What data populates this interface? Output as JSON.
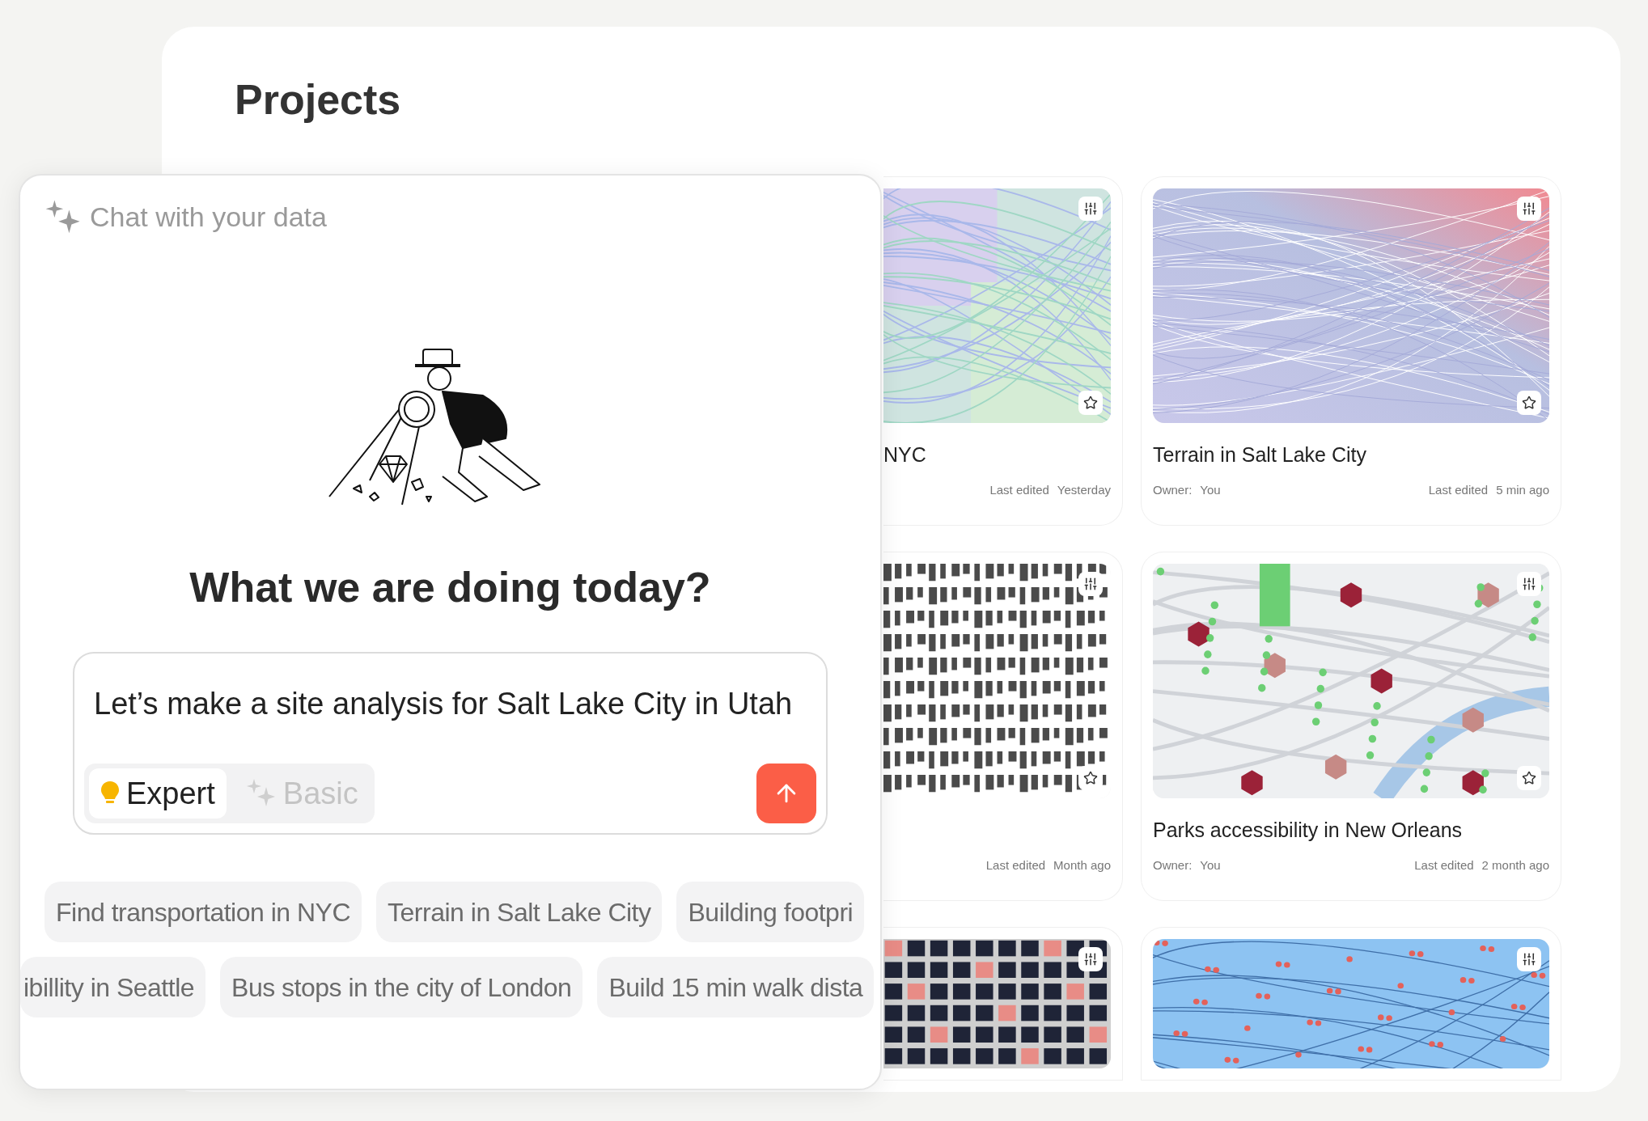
{
  "page": {
    "title": "Projects"
  },
  "projects": [
    {
      "kind": "pastel",
      "title": "NYC",
      "edited_label": "Last edited",
      "edited": "Yesterday",
      "star": true
    },
    {
      "kind": "footprints",
      "edited_label": "Last edited",
      "edited": "Month ago",
      "star": true
    },
    {
      "kind": "blocks"
    },
    {
      "kind": "contours",
      "title": "Terrain in Salt Lake City",
      "owner_label": "Owner:",
      "owner": "You",
      "edited_label": "Last edited",
      "edited": "5 min ago",
      "star": true
    },
    {
      "kind": "parks",
      "title": "Parks accessibility in New Orleans",
      "owner_label": "Owner:",
      "owner": "You",
      "edited_label": "Last edited",
      "edited": "2 month ago",
      "star": true
    },
    {
      "kind": "transit"
    }
  ],
  "chat": {
    "header": "Chat with your data",
    "heading": "What we are doing today?",
    "prompt": "Let’s make a site analysis for Salt Lake City in Utah",
    "modes": [
      {
        "label": "Expert",
        "kind": "bulb",
        "selected": true
      },
      {
        "label": "Basic",
        "kind": "sparkle",
        "selected": false
      }
    ],
    "suggestions": [
      [
        "Find transportation in NYC",
        "Terrain in Salt Lake City",
        "Building footpri"
      ],
      [
        "ibillity in Seattle",
        "Bus stops in the city of London",
        "Build 15 min walk dista"
      ]
    ]
  }
}
